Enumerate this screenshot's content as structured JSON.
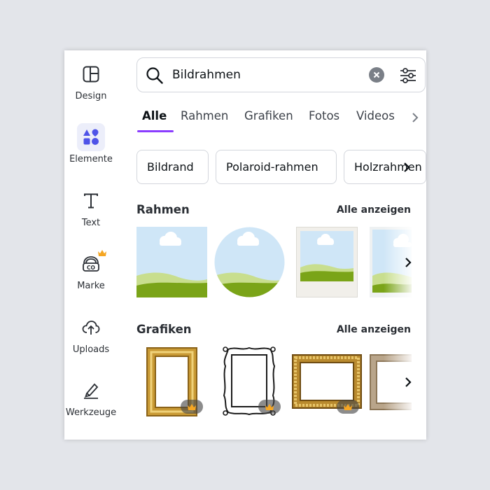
{
  "sidebar": {
    "items": [
      {
        "label": "Design",
        "icon": "layout-icon"
      },
      {
        "label": "Elemente",
        "icon": "shapes-icon",
        "active": true
      },
      {
        "label": "Text",
        "icon": "text-icon"
      },
      {
        "label": "Marke",
        "icon": "brand-icon",
        "premium": true
      },
      {
        "label": "Uploads",
        "icon": "cloud-upload-icon"
      },
      {
        "label": "Werkzeuge",
        "icon": "pen-tool-icon"
      }
    ]
  },
  "search": {
    "value": "Bildrahmen"
  },
  "tabs": [
    {
      "label": "Alle",
      "active": true
    },
    {
      "label": "Rahmen"
    },
    {
      "label": "Grafiken"
    },
    {
      "label": "Fotos"
    },
    {
      "label": "Videos"
    }
  ],
  "chips": [
    "Bildrand",
    "Polaroid-rahmen",
    "Holzrahmen"
  ],
  "sections": {
    "frames": {
      "title": "Rahmen",
      "see_all": "Alle anzeigen"
    },
    "graphics": {
      "title": "Grafiken",
      "see_all": "Alle anzeigen"
    }
  },
  "colors": {
    "accent": "#8b3dff",
    "sky": "#cfe6f7",
    "grass": "#7aa418",
    "gold": "#c99a35",
    "premium": "#f5a623"
  }
}
